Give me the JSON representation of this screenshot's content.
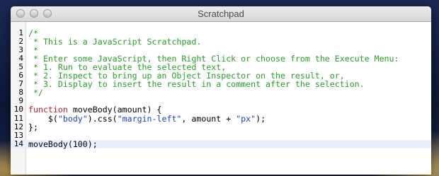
{
  "window": {
    "title": "Scratchpad"
  },
  "lines": [
    {
      "number": "1",
      "segments": [
        {
          "text": "/*",
          "cls": "c"
        }
      ]
    },
    {
      "number": "2",
      "segments": [
        {
          "text": " * This is a JavaScript Scratchpad.",
          "cls": "c"
        }
      ]
    },
    {
      "number": "3",
      "segments": [
        {
          "text": " *",
          "cls": "c"
        }
      ]
    },
    {
      "number": "4",
      "segments": [
        {
          "text": " * Enter some JavaScript, then Right Click or choose from the Execute Menu:",
          "cls": "c"
        }
      ]
    },
    {
      "number": "5",
      "segments": [
        {
          "text": " * 1. Run to evaluate the selected text,",
          "cls": "c"
        }
      ]
    },
    {
      "number": "6",
      "segments": [
        {
          "text": " * 2. Inspect to bring up an Object Inspector on the result, or,",
          "cls": "c"
        }
      ]
    },
    {
      "number": "7",
      "segments": [
        {
          "text": " * 3. Display to insert the result in a comment after the selection.",
          "cls": "c"
        }
      ]
    },
    {
      "number": "8",
      "segments": [
        {
          "text": " */",
          "cls": "c"
        }
      ]
    },
    {
      "number": "9",
      "segments": []
    },
    {
      "number": "10",
      "segments": [
        {
          "text": "function",
          "cls": "k"
        },
        {
          "text": " moveBody(amount) {",
          "cls": "p"
        }
      ]
    },
    {
      "number": "11",
      "segments": [
        {
          "text": "    $(",
          "cls": "p"
        },
        {
          "text": "\"body\"",
          "cls": "s"
        },
        {
          "text": ").css(",
          "cls": "p"
        },
        {
          "text": "\"margin-left\"",
          "cls": "s"
        },
        {
          "text": ", amount + ",
          "cls": "p"
        },
        {
          "text": "\"px\"",
          "cls": "s"
        },
        {
          "text": ");",
          "cls": "p"
        }
      ]
    },
    {
      "number": "12",
      "segments": [
        {
          "text": "};",
          "cls": "p"
        }
      ]
    },
    {
      "number": "13",
      "segments": []
    },
    {
      "number": "14",
      "current": true,
      "segments": [
        {
          "text": "moveBody(100);",
          "cls": "p"
        }
      ]
    }
  ]
}
